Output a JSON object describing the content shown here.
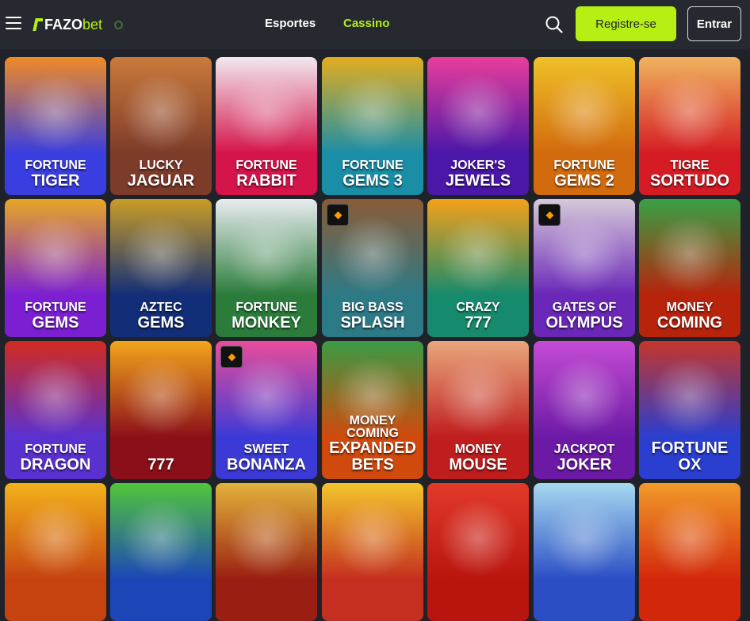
{
  "header": {
    "logo_main": "FAZO",
    "logo_suffix": "bet",
    "nav": {
      "sports": "Esportes",
      "casino": "Cassino"
    },
    "register_label": "Registre-se",
    "login_label": "Entrar"
  },
  "colors": {
    "accent": "#b7ef14",
    "background": "#1f2329",
    "header": "#262a30"
  },
  "games": [
    {
      "line1": "Fortune",
      "line2": "Tiger",
      "bg": "#3a3ee0",
      "art": "#f08a25",
      "badge": false
    },
    {
      "line1": "Lucky",
      "line2": "Jaguar",
      "bg": "#7d3b2a",
      "art": "#c97a3b",
      "badge": false
    },
    {
      "line1": "Fortune",
      "line2": "Rabbit",
      "bg": "#d4144a",
      "art": "#f2e8ef",
      "badge": false
    },
    {
      "line1": "Fortune",
      "line2": "Gems 3",
      "bg": "#1b8ea7",
      "art": "#e2ad1f",
      "badge": false
    },
    {
      "line1": "Joker's",
      "line2": "Jewels",
      "bg": "#4a17a8",
      "art": "#e83e9b",
      "badge": false
    },
    {
      "line1": "Fortune",
      "line2": "Gems 2",
      "bg": "#d26a0e",
      "art": "#efc12a",
      "badge": false
    },
    {
      "line1": "Tigre",
      "line2": "Sortudo",
      "bg": "#d51c24",
      "art": "#f0b35e",
      "badge": false
    },
    {
      "line1": "Fortune",
      "line2": "Gems",
      "bg": "#7c1fd3",
      "art": "#e7a624",
      "badge": false
    },
    {
      "line1": "Aztec",
      "line2": "Gems",
      "bg": "#122e78",
      "art": "#c99c25",
      "badge": false
    },
    {
      "line1": "Fortune",
      "line2": "Monkey",
      "bg": "#2b7c3b",
      "art": "#e8ecef",
      "badge": false
    },
    {
      "line1": "Big Bass",
      "line2": "Splash",
      "bg": "#2d7a87",
      "art": "#8a5b37",
      "badge": true
    },
    {
      "line1": "Crazy",
      "line2": "777",
      "bg": "#168a6c",
      "art": "#f4a01a",
      "badge": false
    },
    {
      "line1": "Gates of",
      "line2": "Olympus",
      "bg": "#6a27b8",
      "art": "#d6c9d9",
      "badge": true
    },
    {
      "line1": "Money",
      "line2": "Coming",
      "bg": "#b8230c",
      "art": "#39a045",
      "badge": false
    },
    {
      "line1": "Fortune",
      "line2": "Dragon",
      "bg": "#5a31d1",
      "art": "#d12a20",
      "badge": false
    },
    {
      "line1": "",
      "line2": "777",
      "bg": "#8b0f19",
      "art": "#f2a51c",
      "badge": false
    },
    {
      "line1": "Sweet",
      "line2": "Bonanza",
      "bg": "#3b3ad6",
      "art": "#e94d9b",
      "badge": true
    },
    {
      "line1": "Money Coming",
      "line2": "Expanded Bets",
      "bg": "#d14a0d",
      "art": "#3b9a44",
      "badge": false
    },
    {
      "line1": "Money",
      "line2": "Mouse",
      "bg": "#c01e1e",
      "art": "#e9a77d",
      "badge": false
    },
    {
      "line1": "Jackpot",
      "line2": "Joker",
      "bg": "#6c1aa6",
      "art": "#c54bd3",
      "badge": false
    },
    {
      "line1": "",
      "line2": "Fortune Ox",
      "bg": "#2a3ed0",
      "art": "#c4362b",
      "badge": false
    },
    {
      "line1": "",
      "line2": "",
      "bg": "#c64310",
      "art": "#f2b21b",
      "badge": false
    },
    {
      "line1": "",
      "line2": "",
      "bg": "#1c46b8",
      "art": "#52c63a",
      "badge": false
    },
    {
      "line1": "",
      "line2": "",
      "bg": "#9a1f12",
      "art": "#e2b33a",
      "badge": false
    },
    {
      "line1": "",
      "line2": "",
      "bg": "#c52f1f",
      "art": "#f3c62b",
      "badge": false
    },
    {
      "line1": "",
      "line2": "",
      "bg": "#b9150f",
      "art": "#e23a2a",
      "badge": false
    },
    {
      "line1": "",
      "line2": "",
      "bg": "#2b4ec4",
      "art": "#a7d9f0",
      "badge": false
    },
    {
      "line1": "",
      "line2": "",
      "bg": "#d3270c",
      "art": "#f29b2a",
      "badge": false
    }
  ]
}
